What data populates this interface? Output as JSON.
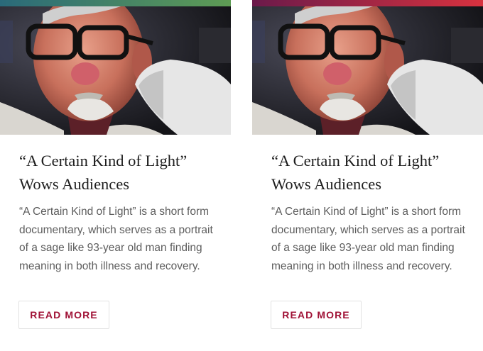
{
  "cards": [
    {
      "accent_gradient": [
        "#2a6a7a",
        "#5e9c54"
      ],
      "title_line1": "“A Certain Kind of Light”",
      "title_line2": "Wows Audiences",
      "description": "“A Certain Kind of Light” is a short form documentary, which serves as a portrait of a sage like 93-year old man finding meaning in both illness and recovery.",
      "button_label": "READ MORE"
    },
    {
      "accent_gradient": [
        "#6b1a4a",
        "#d8323f"
      ],
      "title_line1": "“A Certain Kind of Light”",
      "title_line2": "Wows Audiences",
      "description": "“A Certain Kind of Light” is a short form documentary, which serves as a portrait of a sage like 93-year old man finding meaning in both illness and recovery.",
      "button_label": "READ MORE"
    }
  ],
  "colors": {
    "button_text": "#a01236",
    "title_text": "#1d1d1d",
    "body_text": "#5d5d5d"
  }
}
